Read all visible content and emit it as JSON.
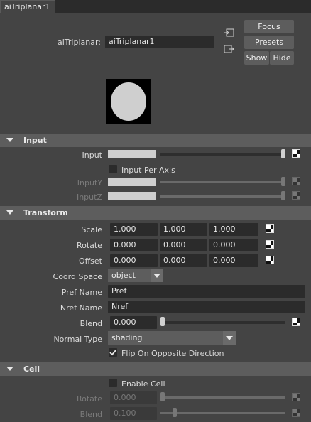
{
  "tab": {
    "label": "aiTriplanar1"
  },
  "header": {
    "node_label": "aiTriplanar:",
    "node_name": "aiTriplanar1",
    "focus": "Focus",
    "presets": "Presets",
    "show": "Show",
    "hide": "Hide"
  },
  "sections": {
    "input": "Input",
    "transform": "Transform",
    "cell": "Cell"
  },
  "input": {
    "input_label": "Input",
    "per_axis_label": "Input Per Axis",
    "per_axis_checked": false,
    "inputy_label": "InputY",
    "inputz_label": "InputZ"
  },
  "transform": {
    "scale_label": "Scale",
    "scale": [
      "1.000",
      "1.000",
      "1.000"
    ],
    "rotate_label": "Rotate",
    "rotate": [
      "0.000",
      "0.000",
      "0.000"
    ],
    "offset_label": "Offset",
    "offset": [
      "0.000",
      "0.000",
      "0.000"
    ],
    "coord_space_label": "Coord Space",
    "coord_space_value": "object",
    "pref_label": "Pref Name",
    "pref_value": "Pref",
    "nref_label": "Nref Name",
    "nref_value": "Nref",
    "blend_label": "Blend",
    "blend_value": "0.000",
    "normal_type_label": "Normal Type",
    "normal_type_value": "shading",
    "flip_label": "Flip On Opposite Direction",
    "flip_checked": true
  },
  "cell": {
    "enable_label": "Enable Cell",
    "enable_checked": false,
    "rotate_label": "Rotate",
    "rotate_value": "0.000",
    "blend_label": "Blend",
    "blend_value": "0.100"
  },
  "colors": {
    "background": "#444444",
    "section_header": "#5d5d5d",
    "field": "#2b2b2b"
  }
}
